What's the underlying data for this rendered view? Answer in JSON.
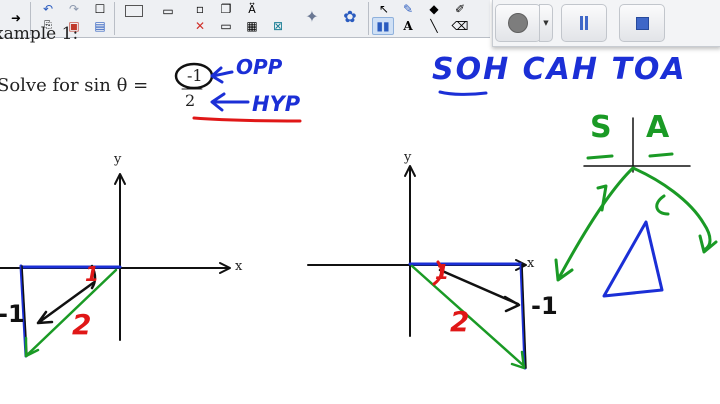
{
  "toolbar": {
    "tools": [
      {
        "name": "next-page-icon",
        "glyph": "➜",
        "active": false
      },
      {
        "name": "undo-icon",
        "glyph": "↶",
        "active": false
      },
      {
        "name": "redo-icon",
        "glyph": "↷",
        "active": false
      },
      {
        "name": "blank-page-icon",
        "glyph": "☐",
        "active": false
      },
      {
        "name": "screen-shade-icon",
        "glyph": "▭",
        "active": false
      },
      {
        "name": "capture-icon",
        "glyph": "▢",
        "active": false
      },
      {
        "name": "paste-icon",
        "glyph": "📋",
        "active": false
      },
      {
        "name": "save-icon",
        "glyph": "💾",
        "active": false
      },
      {
        "name": "delete-icon",
        "glyph": "✕",
        "active": false
      },
      {
        "name": "display-icon",
        "glyph": "⊡",
        "active": false
      },
      {
        "name": "table-icon",
        "glyph": "▦",
        "active": false
      },
      {
        "name": "fit-icon",
        "glyph": "⊠",
        "active": false
      },
      {
        "name": "text-tools-icon",
        "glyph": "Aᵢ",
        "active": false
      },
      {
        "name": "gallery-icon",
        "glyph": "⚙",
        "active": false
      },
      {
        "name": "select-icon",
        "glyph": "↖",
        "active": false
      },
      {
        "name": "pen-icon",
        "glyph": "✎",
        "active": true
      },
      {
        "name": "text-icon",
        "glyph": "A",
        "active": false
      },
      {
        "name": "fill-icon",
        "glyph": "◆",
        "active": false
      },
      {
        "name": "eraser-icon",
        "glyph": "⌫",
        "active": false
      }
    ]
  },
  "recorder": {
    "record_label": "record",
    "pause_label": "pause",
    "stop_label": "stop"
  },
  "lesson": {
    "heading": "xample 1:",
    "problem": "Solve for sin  θ  =",
    "numerator": "-1",
    "denominator": "2",
    "opp_note": "OPP",
    "hyp_note": "HYP",
    "mnemonic": "SOH CAH TOA",
    "cast_s": "S",
    "cast_a": "A"
  },
  "graphs": {
    "left": {
      "x_label": "x",
      "y_label": "y",
      "opposite": "-1",
      "hypotenuse": "2",
      "adjacent_mark": "1"
    },
    "right": {
      "x_label": "x",
      "y_label": "y",
      "opposite": "-1",
      "hypotenuse": "2",
      "adjacent_mark": "1"
    }
  },
  "colors": {
    "ink_blue": "#1b2fd6",
    "ink_red": "#e01717",
    "ink_green": "#1a9a25",
    "ink_black": "#111111"
  }
}
